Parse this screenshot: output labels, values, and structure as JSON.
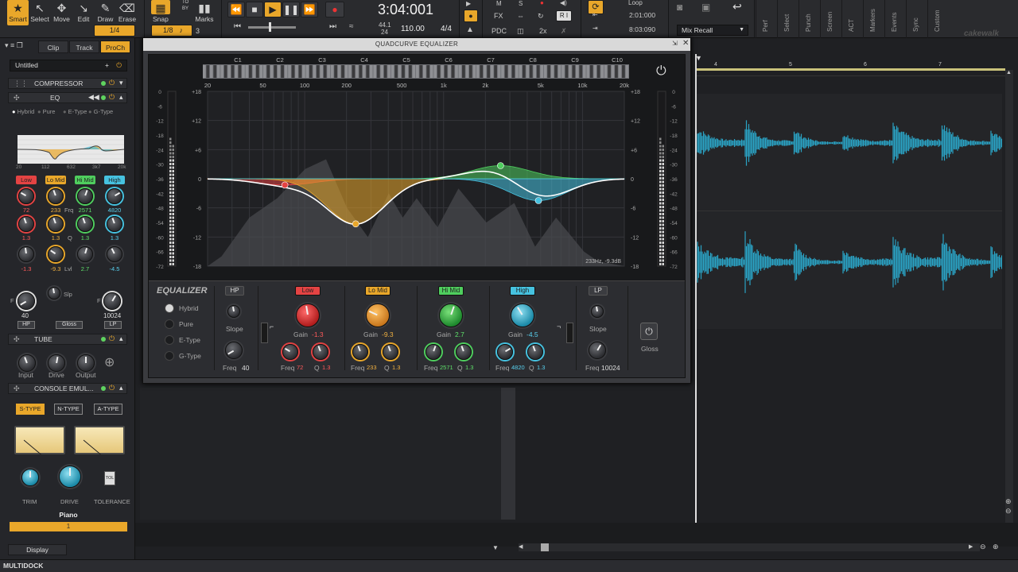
{
  "toolbar": {
    "tools": [
      {
        "label": "Smart",
        "icon": "star-icon",
        "glyph": "★"
      },
      {
        "label": "Select",
        "icon": "pointer-icon",
        "glyph": "↖"
      },
      {
        "label": "Move",
        "icon": "move-icon",
        "glyph": "✥"
      },
      {
        "label": "Edit",
        "icon": "edit-icon",
        "glyph": "↘"
      },
      {
        "label": "Draw",
        "icon": "pencil-icon",
        "glyph": "✎"
      },
      {
        "label": "Erase",
        "icon": "eraser-icon",
        "glyph": "⌫"
      }
    ],
    "tool_quantize": "1/4",
    "snap_label": "Snap",
    "snap_value": "1/8",
    "marks_label": "Marks",
    "marks_num": "3",
    "by_label": "BY",
    "to_label": "TO",
    "time": "3:04:001",
    "sample_rate": "44.1",
    "bit_depth": "24",
    "tempo": "110.00",
    "meter": "4/4",
    "mix_labels": {
      "m": "M",
      "s": "S",
      "fx": "FX",
      "pdc": "PDC",
      "speed": "2x",
      "ri": "R I"
    },
    "loop_label": "Loop",
    "loop_start": "2:01:000",
    "loop_end": "8:03:090",
    "mix_recall": "Mix Recall",
    "vtabs": [
      "Perf",
      "Select",
      "Punch",
      "Screen",
      "ACT",
      "Markers",
      "Events",
      "Sync",
      "Custom"
    ],
    "brand": "cakewalk"
  },
  "prochannel": {
    "tabs": [
      "Clip",
      "Track",
      "ProCh"
    ],
    "preset_name": "Untitled",
    "modules": {
      "compressor": "COMPRESSOR",
      "eq": "EQ",
      "tube": "TUBE",
      "console": "CONSOLE EMUL..."
    },
    "eq_modes": [
      "Hybrid",
      "Pure",
      "E-Type",
      "G-Type"
    ],
    "mini_freq_labels": [
      "20",
      "112",
      "632",
      "3k7",
      "20k"
    ],
    "bands": [
      {
        "name": "Low",
        "freq": "72",
        "q": "1.3",
        "gain": "-1.3"
      },
      {
        "name": "Lo Mid",
        "freq": "233",
        "q": "1.3",
        "gain": "-9.3"
      },
      {
        "name": "Hi Mid",
        "freq": "2571",
        "q": "1.3",
        "gain": "2.7"
      },
      {
        "name": "High",
        "freq": "4820",
        "q": "1.3",
        "gain": "-4.5"
      }
    ],
    "row_labels": {
      "frq": "Frq",
      "q": "Q",
      "lvl": "Lvl",
      "slp": "Slp",
      "f": "F"
    },
    "hp_value": "40",
    "lp_value": "10024",
    "hp_btn": "HP",
    "gloss_btn": "Gloss",
    "lp_btn": "LP",
    "tube_labels": [
      "Input",
      "Drive",
      "Output"
    ],
    "console_types": [
      "S-TYPE",
      "N-TYPE",
      "A-TYPE"
    ],
    "console_knobs": [
      "TRIM",
      "DRIVE",
      "TOLERANCE"
    ],
    "tol_label": "TOL",
    "track_name": "Piano",
    "track_num": "1",
    "display_label": "Display"
  },
  "eq_window": {
    "title": "QUADCURVE EQUALIZER",
    "note_labels": [
      "C1",
      "C2",
      "C3",
      "C4",
      "C5",
      "C6",
      "C7",
      "C8",
      "C9",
      "C10"
    ],
    "freq_labels": [
      "20",
      "50",
      "100",
      "200",
      "500",
      "1k",
      "2k",
      "5k",
      "10k",
      "20k"
    ],
    "db_labels": [
      "+18",
      "+12",
      "+6",
      "0",
      "-6",
      "-12",
      "-18"
    ],
    "meter_labels": [
      "0",
      "-6",
      "-12",
      "-18",
      "-24",
      "-30",
      "-36",
      "-42",
      "-48",
      "-54",
      "-60",
      "-66",
      "-72"
    ],
    "readout": "233Hz, -9.3dB",
    "section_title": "EQUALIZER",
    "modes": [
      "Hybrid",
      "Pure",
      "E-Type",
      "G-Type"
    ],
    "hp": {
      "label": "HP",
      "freq": "40",
      "slope_label": "Slope",
      "freq_label": "Freq"
    },
    "lp": {
      "label": "LP",
      "freq": "10024",
      "slope_label": "Slope",
      "freq_label": "Freq"
    },
    "gloss_label": "Gloss",
    "knob_labels": {
      "gain": "Gain",
      "freq": "Freq",
      "q": "Q"
    },
    "bands": [
      {
        "name": "Low",
        "gain": "-1.3",
        "freq": "72",
        "q": "1.3",
        "color": "#e44343"
      },
      {
        "name": "Lo Mid",
        "gain": "-9.3",
        "freq": "233",
        "q": "1.3",
        "color": "#e9a72a"
      },
      {
        "name": "Hi Mid",
        "gain": "2.7",
        "freq": "2571",
        "q": "1.3",
        "color": "#4fce5e"
      },
      {
        "name": "High",
        "gain": "-4.5",
        "freq": "4820",
        "q": "1.3",
        "color": "#46c2e0"
      }
    ]
  },
  "timeline": {
    "ruler_marks": [
      "4",
      "5",
      "6",
      "7"
    ]
  },
  "multidock": "MULTIDOCK",
  "colors": {
    "accent": "#e9a72a",
    "waveform": "#2aa3c4"
  }
}
